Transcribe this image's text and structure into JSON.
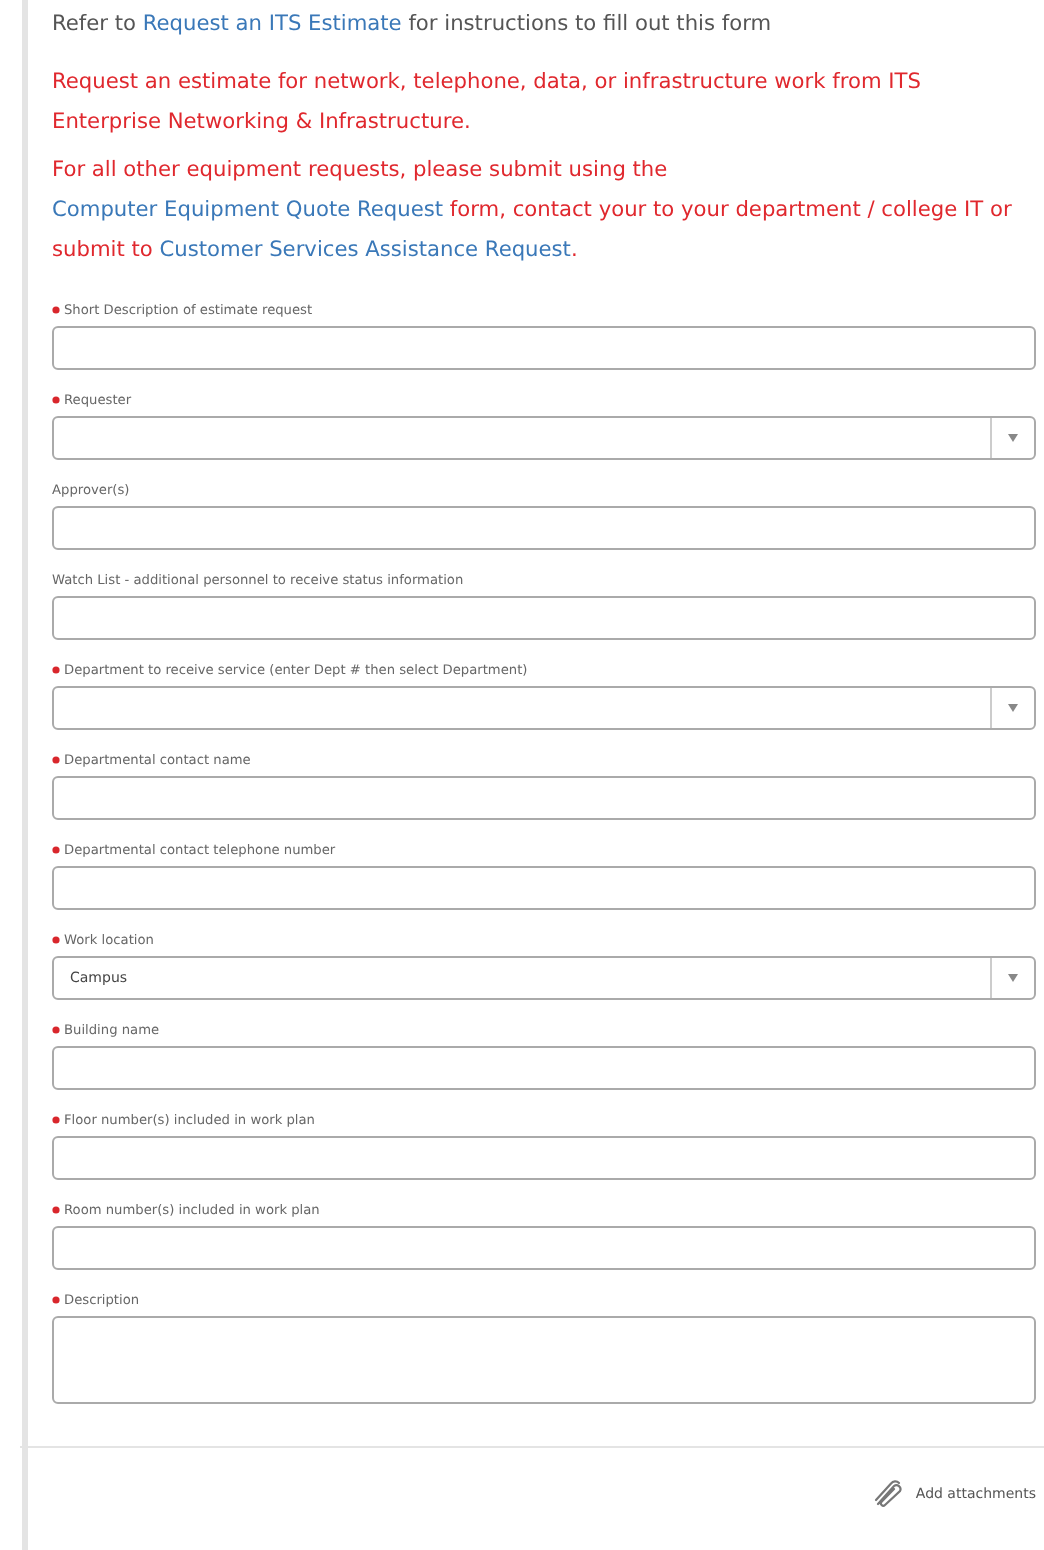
{
  "intro": [
    {
      "kind": "note",
      "parts": [
        {
          "kind": "text",
          "text": "Refer to "
        },
        {
          "kind": "link",
          "text": "Request an ITS Estimate"
        },
        {
          "kind": "text",
          "text": " for instructions to fill out this form"
        }
      ]
    },
    {
      "kind": "warning",
      "parts": [
        {
          "kind": "text",
          "text": "Request an estimate for network, telephone, data, or infrastructure work from ITS Enterprise Networking & Infrastructure."
        }
      ]
    },
    {
      "kind": "warning",
      "parts": [
        {
          "kind": "text",
          "text": "For all other equipment requests, please submit using the "
        },
        {
          "kind": "link",
          "text": "Computer Equipment Quote Request"
        },
        {
          "kind": "text",
          "text": " form, contact your to your department / college IT or submit to "
        },
        {
          "kind": "link",
          "text": "Customer Services Assistance Request"
        },
        {
          "kind": "text",
          "text": "."
        }
      ]
    }
  ],
  "fields": [
    {
      "label": "Short Description of estimate request",
      "required": true,
      "kind": "text"
    },
    {
      "label": "Requester",
      "required": true,
      "kind": "select"
    },
    {
      "label": "Approver(s)",
      "required": false,
      "kind": "text"
    },
    {
      "label": "Watch List - additional personnel to receive status information",
      "required": false,
      "kind": "text"
    },
    {
      "label": "Department to receive service (enter Dept # then select Department)",
      "required": true,
      "kind": "select"
    },
    {
      "label": "Departmental contact name",
      "required": true,
      "kind": "text"
    },
    {
      "label": "Departmental contact telephone number",
      "required": true,
      "kind": "text"
    },
    {
      "label": "Work location",
      "required": true,
      "kind": "select",
      "value": "Campus"
    },
    {
      "label": "Building name",
      "required": true,
      "kind": "text"
    },
    {
      "label": "Floor number(s) included in work plan",
      "required": true,
      "kind": "text"
    },
    {
      "label": "Room number(s) included in work plan",
      "required": true,
      "kind": "text"
    },
    {
      "label": "Description",
      "required": true,
      "kind": "textarea"
    }
  ],
  "footer": {
    "attach_label": "Add attachments"
  }
}
